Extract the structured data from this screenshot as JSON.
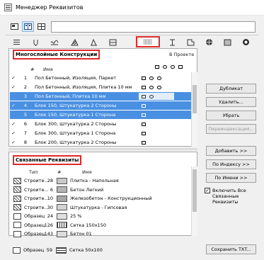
{
  "window": {
    "title": "Менеджер Реквизитов"
  },
  "toolbar": {
    "icons": [
      "view-list-icon",
      "view-split-icon",
      "view-grid-icon"
    ]
  },
  "tabs": [
    {
      "icon": "lines-icon"
    },
    {
      "icon": "pen-icon"
    },
    {
      "icon": "linetype-icon"
    },
    {
      "icon": "fill-icon"
    },
    {
      "icon": "composite-icon",
      "selected": true
    },
    {
      "icon": "profile-icon"
    },
    {
      "icon": "zone-icon"
    },
    {
      "icon": "globe-icon"
    },
    {
      "icon": "surface-icon"
    },
    {
      "icon": "markup-icon"
    },
    {
      "icon": "circle-icon"
    }
  ],
  "top_panel": {
    "section_label": "Многослойные Конструкции",
    "scope": "В Проекте",
    "col_num": "#",
    "col_name": "Имя",
    "rows": [
      {
        "check": "✓",
        "num": "1",
        "name": "Пол Бетонный, Изоляция, Паркет",
        "selected": false
      },
      {
        "check": "✓",
        "num": "2",
        "name": "Пол Бетонный, Изоляция, Плитка 10 мм",
        "selected": false
      },
      {
        "check": "",
        "num": "3",
        "name": "Пол Бетонный, Плитка 10 мм",
        "selected": true
      },
      {
        "check": "✓",
        "num": "4",
        "name": "Блок 150, Штукатурка 2 Стороны",
        "selected": true
      },
      {
        "check": "",
        "num": "5",
        "name": "Блок 150, Штукатурка 1 Сторона",
        "selected": true
      },
      {
        "check": "✓",
        "num": "6",
        "name": "Блок 300, Штукатурка 2 Стороны",
        "selected": false
      },
      {
        "check": "✓",
        "num": "7",
        "name": "Блок 300, Штукатурка 1 Сторона",
        "selected": false
      },
      {
        "check": "✓",
        "num": "8",
        "name": "Блок 200, Штукатурка 2 Стороны",
        "selected": false
      }
    ]
  },
  "buttons": {
    "duplicate": "Дубликат",
    "delete": "Удалить...",
    "remove": "Убрать",
    "reindex": "Переиндексация...",
    "add": "Добавить >>",
    "by_index": "По Индексу >>",
    "by_name": "По Имени >>",
    "save_txt": "Сохранить TXT..."
  },
  "include_linked": {
    "label": "Включить Все Связанные Реквизиты",
    "checked": true
  },
  "bottom_panel": {
    "section_label": "Связанные Реквизиты",
    "col_type": "Тип",
    "col_num": "#",
    "col_name": "Имя",
    "rows": [
      {
        "type": "Строите...",
        "num": "28",
        "swatch": "#c9c9c9",
        "name": "Плитка - Напольная"
      },
      {
        "type": "Строите...",
        "num": "6",
        "swatch": "#b5b5b5",
        "name": "Бетон Легкий"
      },
      {
        "type": "Строите...",
        "num": "10",
        "swatch": "#a7a7a7",
        "name": "Железобетон - Конструкционный"
      },
      {
        "type": "Строите...",
        "num": "30",
        "swatch": "#d2d2d2",
        "name": "Штукатурка - Гипсовая"
      },
      {
        "type": "Образец",
        "num": "24",
        "swatch": "#e0e0e0",
        "name": "25 %"
      },
      {
        "type": "Образец",
        "num": "126",
        "swatch": "#ffffff",
        "name": "Сетка 150x150"
      },
      {
        "type": "Образец",
        "num": "143",
        "swatch": "#dcdcdc",
        "name": "Бетон 01"
      },
      {
        "type": "Образец",
        "num": "59",
        "swatch": "#ffffff",
        "name": "Сетка 50x100"
      }
    ]
  }
}
